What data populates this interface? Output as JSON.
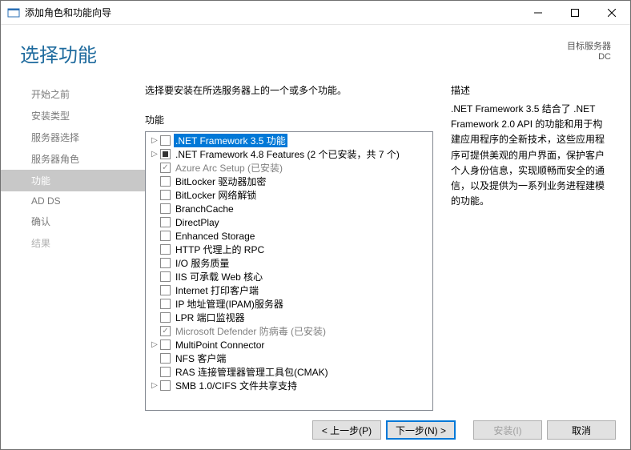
{
  "window": {
    "title": "添加角色和功能向导"
  },
  "header": {
    "title": "选择功能",
    "target_label": "目标服务器",
    "target_value": "DC"
  },
  "nav": {
    "items": [
      {
        "label": "开始之前",
        "state": "normal"
      },
      {
        "label": "安装类型",
        "state": "normal"
      },
      {
        "label": "服务器选择",
        "state": "normal"
      },
      {
        "label": "服务器角色",
        "state": "normal"
      },
      {
        "label": "功能",
        "state": "active"
      },
      {
        "label": "AD DS",
        "state": "normal"
      },
      {
        "label": "确认",
        "state": "normal"
      },
      {
        "label": "结果",
        "state": "disabled"
      }
    ]
  },
  "main": {
    "instruction": "选择要安装在所选服务器上的一个或多个功能。",
    "features_label": "功能",
    "description_label": "描述",
    "description_text": ".NET Framework 3.5 结合了 .NET Framework 2.0 API 的功能和用于构建应用程序的全新技术，这些应用程序可提供美观的用户界面，保护客户个人身份信息，实现顺畅而安全的通信，以及提供为一系列业务进程建模的功能。"
  },
  "features": [
    {
      "label": ".NET Framework 3.5 功能",
      "check": "none",
      "expand": "closed",
      "selected": true
    },
    {
      "label": ".NET Framework 4.8 Features (2 个已安装，共 7 个)",
      "check": "partial",
      "expand": "closed"
    },
    {
      "label": "Azure Arc Setup (已安装)",
      "check": "checked",
      "expand": "none",
      "installed": true
    },
    {
      "label": "BitLocker 驱动器加密",
      "check": "none",
      "expand": "none"
    },
    {
      "label": "BitLocker 网络解锁",
      "check": "none",
      "expand": "none"
    },
    {
      "label": "BranchCache",
      "check": "none",
      "expand": "none"
    },
    {
      "label": "DirectPlay",
      "check": "none",
      "expand": "none"
    },
    {
      "label": "Enhanced Storage",
      "check": "none",
      "expand": "none"
    },
    {
      "label": "HTTP 代理上的 RPC",
      "check": "none",
      "expand": "none"
    },
    {
      "label": "I/O 服务质量",
      "check": "none",
      "expand": "none"
    },
    {
      "label": "IIS 可承载 Web 核心",
      "check": "none",
      "expand": "none"
    },
    {
      "label": "Internet 打印客户端",
      "check": "none",
      "expand": "none"
    },
    {
      "label": "IP 地址管理(IPAM)服务器",
      "check": "none",
      "expand": "none"
    },
    {
      "label": "LPR 端口监视器",
      "check": "none",
      "expand": "none"
    },
    {
      "label": "Microsoft Defender 防病毒 (已安装)",
      "check": "checked",
      "expand": "none",
      "installed": true
    },
    {
      "label": "MultiPoint Connector",
      "check": "none",
      "expand": "closed"
    },
    {
      "label": "NFS 客户端",
      "check": "none",
      "expand": "none"
    },
    {
      "label": "RAS 连接管理器管理工具包(CMAK)",
      "check": "none",
      "expand": "none"
    },
    {
      "label": "SMB 1.0/CIFS 文件共享支持",
      "check": "none",
      "expand": "closed"
    }
  ],
  "footer": {
    "prev": "< 上一步(P)",
    "next": "下一步(N) >",
    "install": "安装(I)",
    "cancel": "取消"
  }
}
